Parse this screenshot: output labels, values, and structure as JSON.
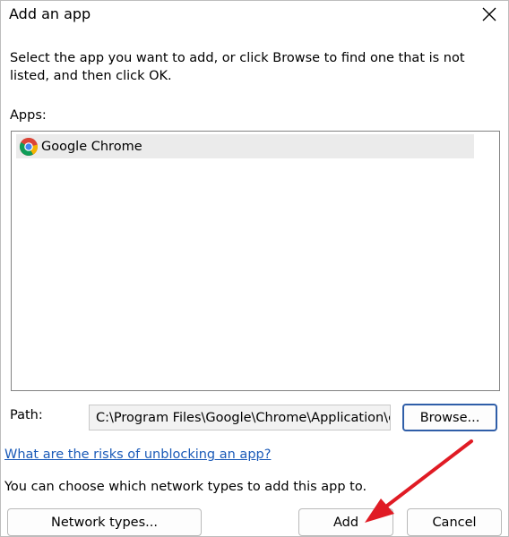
{
  "window": {
    "title": "Add an app"
  },
  "instructions": "Select the app you want to add, or click Browse to find one that is not listed, and then click OK.",
  "apps": {
    "label": "Apps:",
    "items": [
      {
        "name": "Google Chrome",
        "icon": "chrome-icon"
      }
    ]
  },
  "path": {
    "label": "Path:",
    "value": "C:\\Program Files\\Google\\Chrome\\Application\\chrome.exe"
  },
  "buttons": {
    "browse": "Browse...",
    "network_types": "Network types...",
    "add": "Add",
    "cancel": "Cancel"
  },
  "risks_link": "What are the risks of unblocking an app?",
  "network_text": "You can choose which network types to add this app to.",
  "colors": {
    "annotation_arrow": "#e01b24",
    "link": "#1a5ab8",
    "focus_border": "#2f5ea8"
  }
}
